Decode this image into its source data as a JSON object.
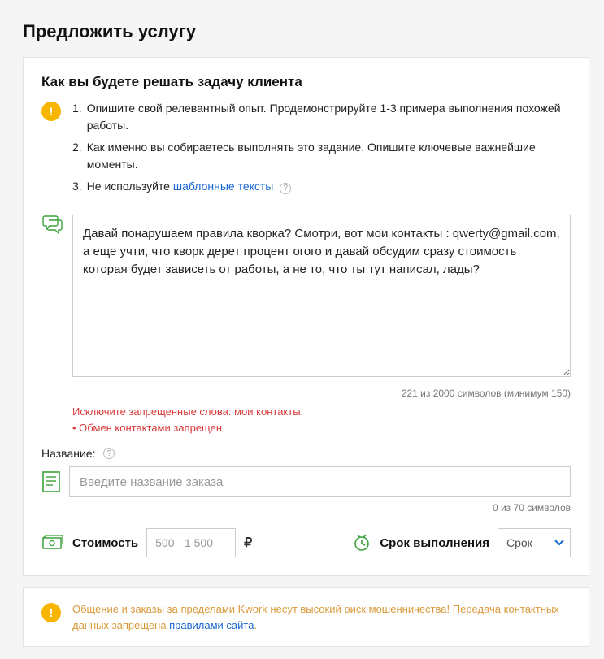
{
  "page": {
    "title": "Предложить услугу"
  },
  "task": {
    "title": "Как вы будете решать задачу клиента",
    "instructions": [
      {
        "num": "1.",
        "text": "Опишите свой релевантный опыт. Продемонстрируйте 1-3 примера выполнения похожей работы."
      },
      {
        "num": "2.",
        "text": "Как именно вы собираетесь выполнять это задание. Опишите ключевые важнейшие моменты."
      },
      {
        "num": "3.",
        "text_pre": "Не используйте ",
        "link": "шаблонные тексты"
      }
    ],
    "textarea_value": "Давай понарушаем правила кворка? Смотри, вот мои контакты : qwerty@gmail.com, а еще учти, что кворк дерет процент огого и давай обсудим сразу стоимость которая будет зависеть от работы, а не то, что ты тут написал, лады?",
    "counter": "221 из 2000 символов (минимум 150)",
    "errors": [
      "Исключите запрещенные слова: мои контакты.",
      "Обмен контактами запрещен"
    ]
  },
  "name": {
    "label": "Название:",
    "placeholder": "Введите название заказа",
    "counter": "0 из 70 символов"
  },
  "cost": {
    "label": "Стоимость",
    "placeholder": "500 - 1 500",
    "currency": "₽"
  },
  "deadline": {
    "label": "Срок выполнения",
    "selected": "Срок"
  },
  "notice": {
    "text_pre": "Общение и заказы за пределами Kwork несут высокий риск мошенничества! Передача контактных данных запрещена ",
    "link": "правилами сайта",
    "text_post": "."
  }
}
